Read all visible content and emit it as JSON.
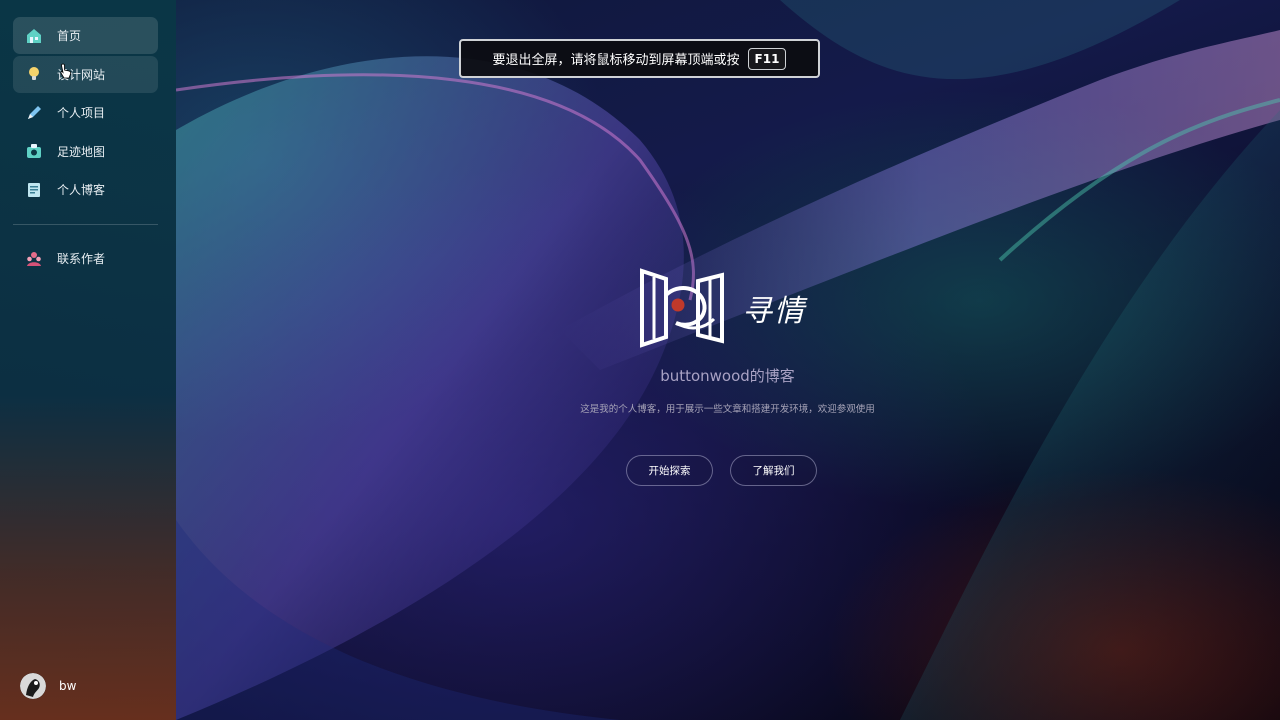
{
  "sidebar": {
    "items": [
      {
        "label": "首页",
        "icon": "house-icon",
        "state": "active"
      },
      {
        "label": "设计网站",
        "icon": "lightbulb-icon",
        "state": "hover"
      },
      {
        "label": "个人项目",
        "icon": "pen-icon",
        "state": ""
      },
      {
        "label": "足迹地图",
        "icon": "camera-bag-icon",
        "state": ""
      },
      {
        "label": "个人博客",
        "icon": "notebook-icon",
        "state": ""
      }
    ],
    "contact": {
      "label": "联系作者",
      "icon": "people-icon"
    },
    "user": {
      "name": "bw"
    }
  },
  "toast": {
    "message": "要退出全屏，请将鼠标移动到屏幕顶端或按",
    "key": "F11"
  },
  "hero": {
    "brand": "寻情",
    "subtitle": "buttonwood的博客",
    "description": "这是我的个人博客，用于展示一些文章和搭建开发环境，欢迎参观使用",
    "buttons": {
      "explore": "开始探索",
      "about": "了解我们"
    }
  },
  "colors": {
    "sidebar_top": "#0a3746",
    "sidebar_bottom": "#6e321c",
    "logo_dot": "#c0392b",
    "toast_bg": "#0c0c10"
  }
}
